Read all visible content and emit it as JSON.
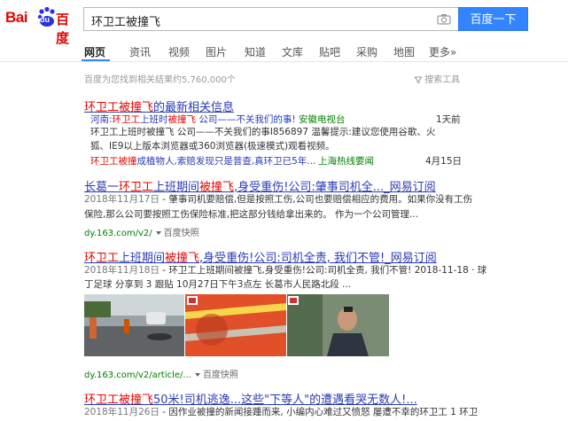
{
  "logo": {
    "bai": "Bai",
    "du": "du",
    "baidu": "百度"
  },
  "search": {
    "query": "环卫工被撞飞",
    "button": "百度一下"
  },
  "tabs": [
    "网页",
    "资讯",
    "视频",
    "图片",
    "知道",
    "文库",
    "贴吧",
    "采购",
    "地图",
    "更多»"
  ],
  "meta": {
    "count": "百度为您找到相关结果约5,760,000个",
    "tools": "搜索工具"
  },
  "news_block": {
    "title_pre": "环卫工被撞飞",
    "title_post": "的最新相关信息",
    "rows": [
      {
        "pre": "河南:",
        "red1": "环卫工",
        "mid": "上班时",
        "red2": "被撞飞",
        "post": " 公司——不关我们的事!",
        "source": "安徽电视台",
        "time": "1天前"
      },
      {
        "text": "狐、IE9以上版本浏览器或360浏览器(极速模式)观看视频。"
      },
      {
        "red1": "环卫工被撞",
        "mid": "成植物人,索赔发现只是普查,真环卫已5年...",
        "source": "上海热线要闻",
        "time": "4月15日"
      }
    ],
    "row0_cont": "环卫工上班时被撞飞 公司——不关我们的事I856897 温馨提示:建议您使用谷歌、火"
  },
  "result1": {
    "title_pre": "长葛一",
    "title_red1": "环卫工",
    "title_mid": "上班期间",
    "title_red2": "被撞飞",
    "title_post": ",身受重伤!公司:肇事司机全..._网易订阅",
    "snippet1_date": "2018年11月17日",
    "snippet1": " - 肇事司机要赔偿,但是按照工伤,公司也要赔偿相应的费用。如果你没有工伤",
    "snippet2": "保险,那么公司要按照工伤保险标准,把这部分钱给拿出来的。 作为一个公司管理...",
    "url": "dy.163.com/v2/",
    "snap": "百度快照"
  },
  "result2": {
    "title_pre": "环卫工",
    "title_mid1": "上班期间",
    "title_red": "被撞飞",
    "title_post": ",身受重伤!公司:司机全责, 我们不管!_网易订阅",
    "snippet1_date": "2018年11月18日",
    "snippet1": " - 环卫工上班期间被撞飞,身受重伤!公司:司机全责, 我们不管! 2018-11-18 · 球",
    "snippet2": "丁足球 分享到 3 跟贴 10月27日下午3点左 长葛市人民路北段 ...",
    "url": "dy.163.com/v2/article/...",
    "snap": "百度快照"
  },
  "result3": {
    "title_red": "环卫工被撞飞",
    "title_post": "50米!司机逃逸...这些\"下等人\"的遭遇看哭无数人!...",
    "snippet_date": "2018年11月26日",
    "snippet": " - 因作业被撞的新闻接踵而来, 小编内心难过又愤怒 屡遭不幸的环卫工 1 环卫"
  },
  "colors": {
    "link": "#2a3bb5",
    "highlight": "#e10601",
    "url": "#008000",
    "accent": "#3385ff"
  }
}
